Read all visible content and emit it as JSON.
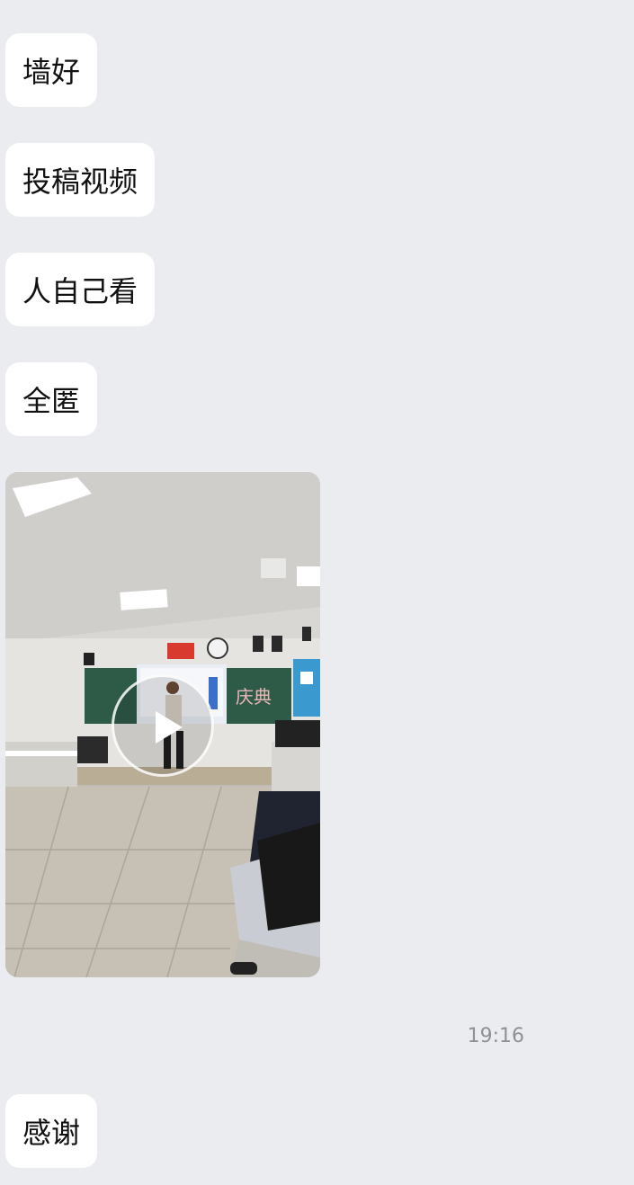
{
  "messages": [
    {
      "text": "墙好"
    },
    {
      "text": "投稿视频"
    },
    {
      "text": "人自己看"
    },
    {
      "text": "全匿"
    }
  ],
  "video": {
    "board_text": "庆典",
    "icon": "play-icon"
  },
  "timestamp": "19:16",
  "last_message": {
    "text": "感谢"
  }
}
